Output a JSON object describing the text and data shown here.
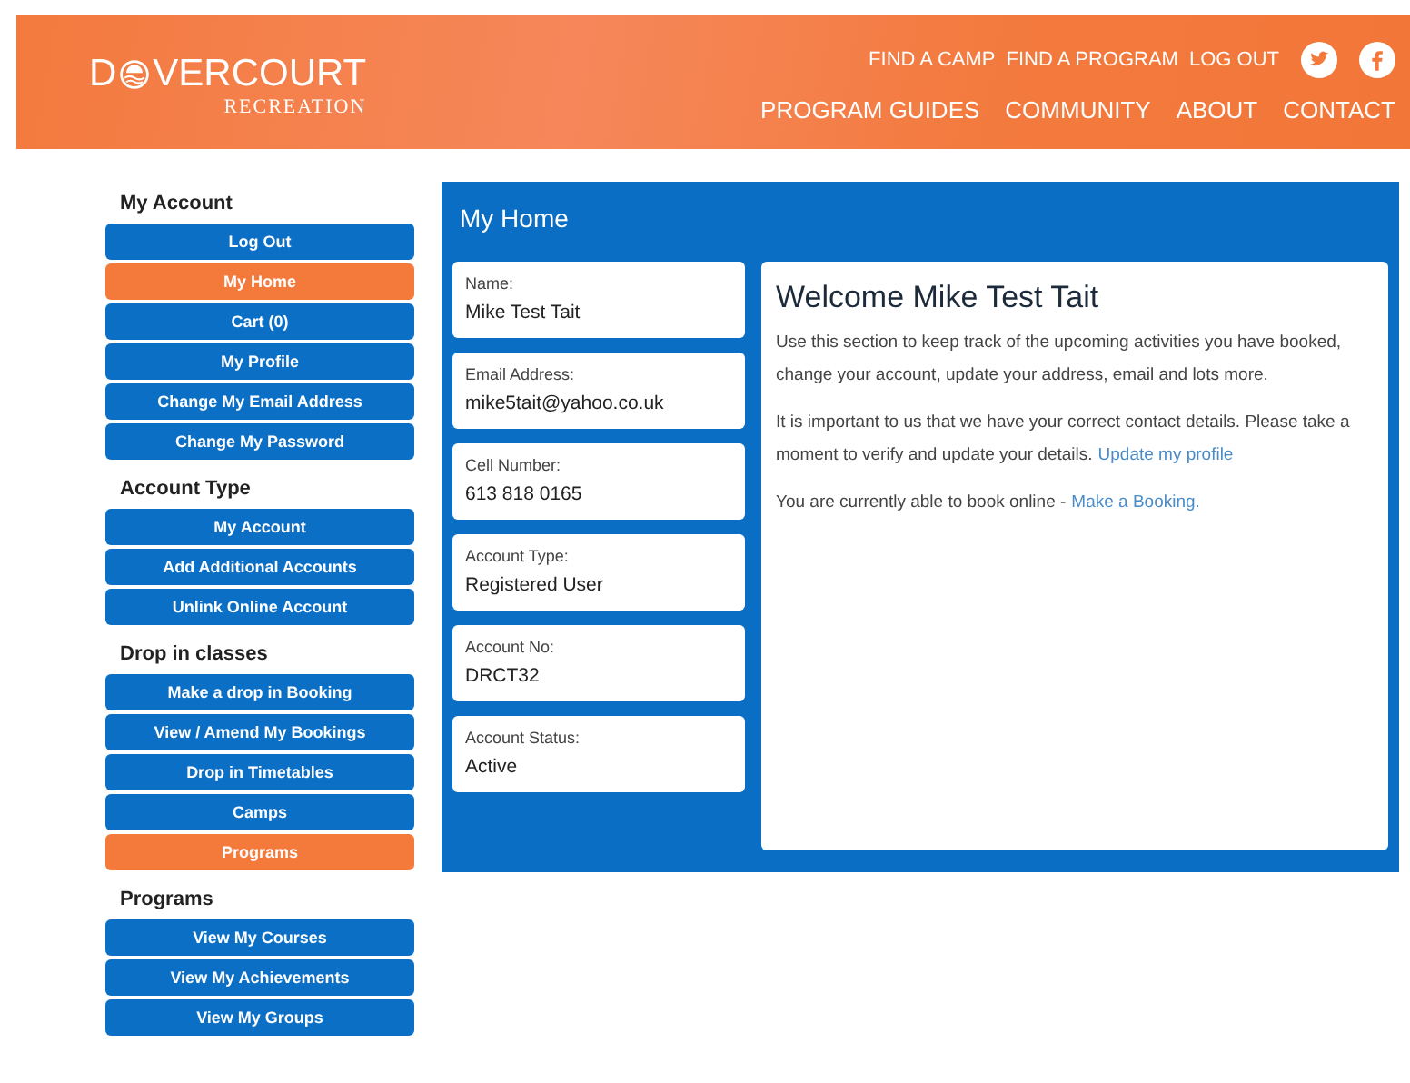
{
  "header": {
    "logo": {
      "before": "D",
      "after": "VERCOURT",
      "subtitle": "RECREATION"
    },
    "top_links": [
      "FIND A CAMP",
      "FIND A PROGRAM",
      "LOG OUT"
    ],
    "social": [
      {
        "kind": "twitter"
      },
      {
        "kind": "facebook"
      }
    ],
    "nav": [
      "PROGRAM GUIDES",
      "COMMUNITY",
      "ABOUT",
      "CONTACT"
    ]
  },
  "sidebar": [
    {
      "title": "My Account",
      "items": [
        {
          "label": "Log Out",
          "selected": false
        },
        {
          "label": "My Home",
          "selected": true
        },
        {
          "label": "Cart (0)",
          "selected": false
        },
        {
          "label": "My Profile",
          "selected": false
        },
        {
          "label": "Change My Email Address",
          "selected": false
        },
        {
          "label": "Change My Password",
          "selected": false
        }
      ]
    },
    {
      "title": "Account Type",
      "items": [
        {
          "label": "My Account",
          "selected": false
        },
        {
          "label": "Add Additional Accounts",
          "selected": false
        },
        {
          "label": "Unlink Online Account",
          "selected": false
        }
      ]
    },
    {
      "title": "Drop in classes",
      "items": [
        {
          "label": "Make a drop in Booking",
          "selected": false
        },
        {
          "label": "View / Amend My Bookings",
          "selected": false
        },
        {
          "label": "Drop in Timetables",
          "selected": false
        },
        {
          "label": "Camps",
          "selected": false
        },
        {
          "label": "Programs",
          "selected": true
        }
      ]
    },
    {
      "title": "Programs",
      "items": [
        {
          "label": "View My Courses",
          "selected": false
        },
        {
          "label": "View My Achievements",
          "selected": false
        },
        {
          "label": "View My Groups",
          "selected": false
        }
      ]
    }
  ],
  "panel": {
    "title": "My Home",
    "details": [
      {
        "label": "Name:",
        "value": "Mike Test Tait"
      },
      {
        "label": "Email Address:",
        "value": "mike5tait@yahoo.co.uk"
      },
      {
        "label": "Cell Number:",
        "value": "613 818 0165"
      },
      {
        "label": "Account Type:",
        "value": "Registered User"
      },
      {
        "label": "Account No:",
        "value": "DRCT32"
      },
      {
        "label": "Account Status:",
        "value": "Active"
      }
    ],
    "welcome": {
      "heading": "Welcome Mike Test Tait",
      "paragraphs": [
        {
          "text": "Use this section to keep track of the upcoming activities you have booked, change your account, update your address, email and lots more."
        },
        {
          "text": "It is important to us that we have your correct contact details. Please take a moment to verify and update your details.",
          "link": "Update my profile"
        },
        {
          "text": "You are currently able to book online -",
          "link": "Make a Booking."
        }
      ]
    }
  }
}
